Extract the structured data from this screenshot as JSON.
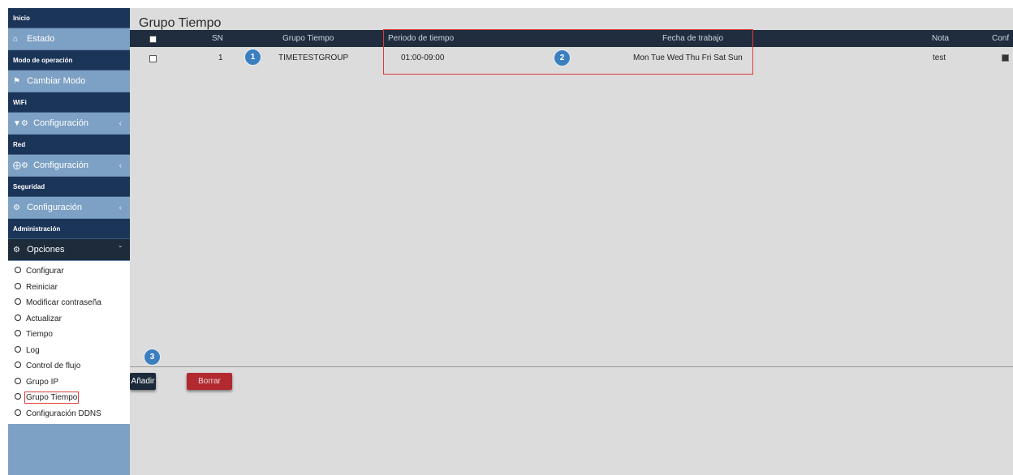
{
  "sidebar": {
    "sections": [
      {
        "header": "Inicio",
        "item": {
          "icon": "home-icon",
          "label": "Estado"
        }
      },
      {
        "header": "Modo de operación",
        "item": {
          "icon": "flag-icon",
          "label": "Cambiar Modo"
        }
      },
      {
        "header": "WiFi",
        "item": {
          "icon": "wifi-cogs-icon",
          "label": "Configuración"
        }
      },
      {
        "header": "Red",
        "item": {
          "icon": "globe-cogs-icon",
          "label": "Configuración"
        }
      },
      {
        "header": "Seguridad",
        "item": {
          "icon": "cogs-icon",
          "label": "Configuración"
        }
      },
      {
        "header": "Administración",
        "item": {
          "icon": "gear-icon",
          "label": "Opciones"
        }
      }
    ],
    "options_submenu": [
      "Configurar",
      "Reiniciar",
      "Modificar contraseña",
      "Actualizar",
      "Tiempo",
      "Log",
      "Control de flujo",
      "Grupo IP",
      "Grupo Tiempo",
      "Configuración DDNS"
    ],
    "active_submenu": "Grupo Tiempo"
  },
  "main": {
    "title": "Grupo Tiempo",
    "table": {
      "headers": {
        "sn": "SN",
        "group": "Grupo Tiempo",
        "period": "Periodo de tiempo",
        "days": "Fecha de trabajo",
        "note": "Nota",
        "config": "Conf"
      },
      "rows": [
        {
          "sn": "1",
          "group": "TIMETESTGROUP",
          "period": "01:00-09:00",
          "days": "Mon Tue Wed Thu Fri Sat Sun",
          "note": "test"
        }
      ]
    },
    "badges": {
      "one": "1",
      "two": "2",
      "three": "3"
    },
    "buttons": {
      "add": "Añadir",
      "delete": "Borrar"
    }
  },
  "colors": {
    "sidebar_header": "#1b3558",
    "sidebar_item": "#7da1c4",
    "table_header": "#1f2d3e",
    "highlight_red": "#e03a3a",
    "badge_blue": "#3c7fbf",
    "delete_button": "#b22a30"
  }
}
